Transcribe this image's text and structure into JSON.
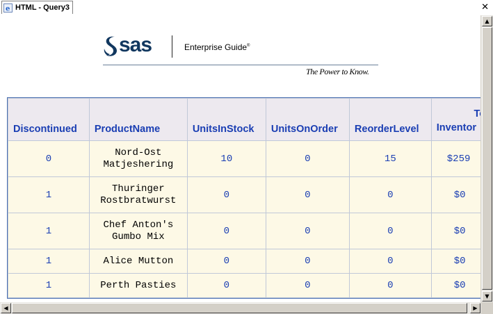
{
  "tab": {
    "label": "HTML - Query3",
    "icon": "ie-document-icon"
  },
  "logo": {
    "brand": "sas",
    "product": "Enterprise Guide",
    "reg": "®",
    "tagline": "The Power to Know."
  },
  "table": {
    "headers": [
      "Discontinued",
      "ProductName",
      "UnitsInStock",
      "UnitsOnOrder",
      "ReorderLevel",
      "Tot Inventor"
    ],
    "header_last_lines": [
      "Tot",
      "Inventor"
    ],
    "rows": [
      {
        "discontinued": "0",
        "name1": "Nord-Ost",
        "name2": "Matjeshering",
        "stock": "10",
        "order": "0",
        "reorder": "15",
        "total": "$259"
      },
      {
        "discontinued": "1",
        "name1": "Thuringer",
        "name2": "Rostbratwurst",
        "stock": "0",
        "order": "0",
        "reorder": "0",
        "total": "$0"
      },
      {
        "discontinued": "1",
        "name1": "Chef Anton's",
        "name2": "Gumbo Mix",
        "stock": "0",
        "order": "0",
        "reorder": "0",
        "total": "$0"
      },
      {
        "discontinued": "1",
        "name1": "Alice Mutton",
        "name2": "",
        "stock": "0",
        "order": "0",
        "reorder": "0",
        "total": "$0"
      },
      {
        "discontinued": "1",
        "name1": "Perth Pasties",
        "name2": "",
        "stock": "0",
        "order": "0",
        "reorder": "0",
        "total": "$0"
      }
    ]
  },
  "colors": {
    "header_text": "#1a3eb3",
    "header_bg": "#ede9ef",
    "cell_bg": "#fdf9e6",
    "border": "#4a6fb0"
  }
}
